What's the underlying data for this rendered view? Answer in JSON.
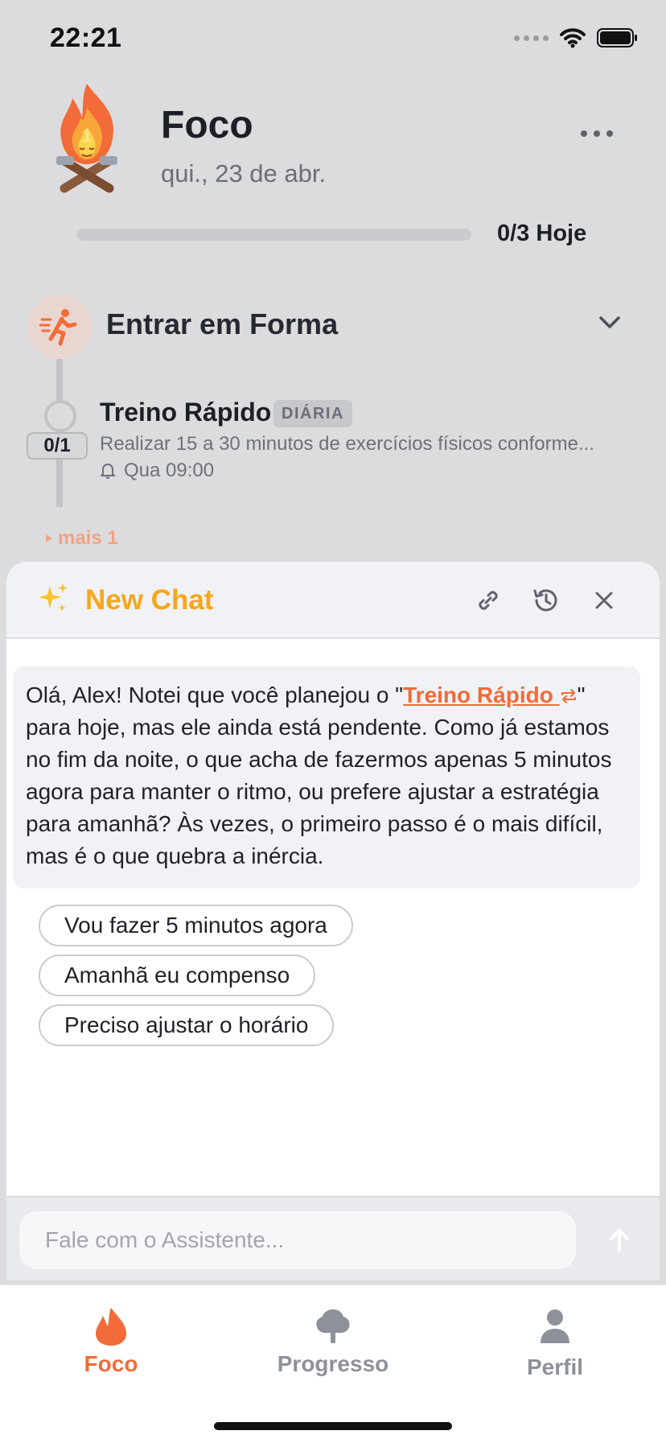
{
  "status_bar": {
    "time": "22:21",
    "icons": [
      "signal-icon",
      "wifi-icon",
      "battery-icon"
    ]
  },
  "header": {
    "streak_number": "1",
    "title": "Foco",
    "date": "qui., 23 de abr.",
    "progress_text": "0/3 Hoje",
    "progress_fraction": 0
  },
  "goal": {
    "title": "Entrar em Forma",
    "icon": "running-person-icon",
    "tasks": [
      {
        "title": "Treino Rápido",
        "badge": "DIÁRIA",
        "counter": "0/1",
        "description": "Realizar 15 a 30 minutos de exercícios físicos conforme...",
        "reminder": "Qua 09:00"
      }
    ],
    "more_link": "mais 1"
  },
  "chat": {
    "title": "New Chat",
    "header_icons": [
      "link-icon",
      "history-icon",
      "close-icon"
    ],
    "message": {
      "before_link": "Olá, Alex! Notei que você planejou o \"",
      "link_text": "Treino Rápido",
      "after_link": "\" para hoje, mas ele ainda está pendente. Como já estamos no fim da noite, o que acha de fazermos apenas 5 minutos agora para manter o ritmo, ou prefere ajustar a estratégia para amanhã? Às vezes, o primeiro passo é o mais difícil, mas é o que quebra a inércia."
    },
    "suggestions": [
      "Vou fazer 5 minutos agora",
      "Amanhã eu compenso",
      "Preciso ajustar o horário"
    ],
    "input_placeholder": "Fale com o Assistente..."
  },
  "tabs": [
    {
      "label": "Foco",
      "icon": "flame-icon",
      "active": true
    },
    {
      "label": "Progresso",
      "icon": "tree-icon",
      "active": false
    },
    {
      "label": "Perfil",
      "icon": "person-icon",
      "active": false
    }
  ],
  "colors": {
    "accent": "#f26b38",
    "chat_title": "#f7a61c",
    "tab_inactive": "#8e919a"
  }
}
